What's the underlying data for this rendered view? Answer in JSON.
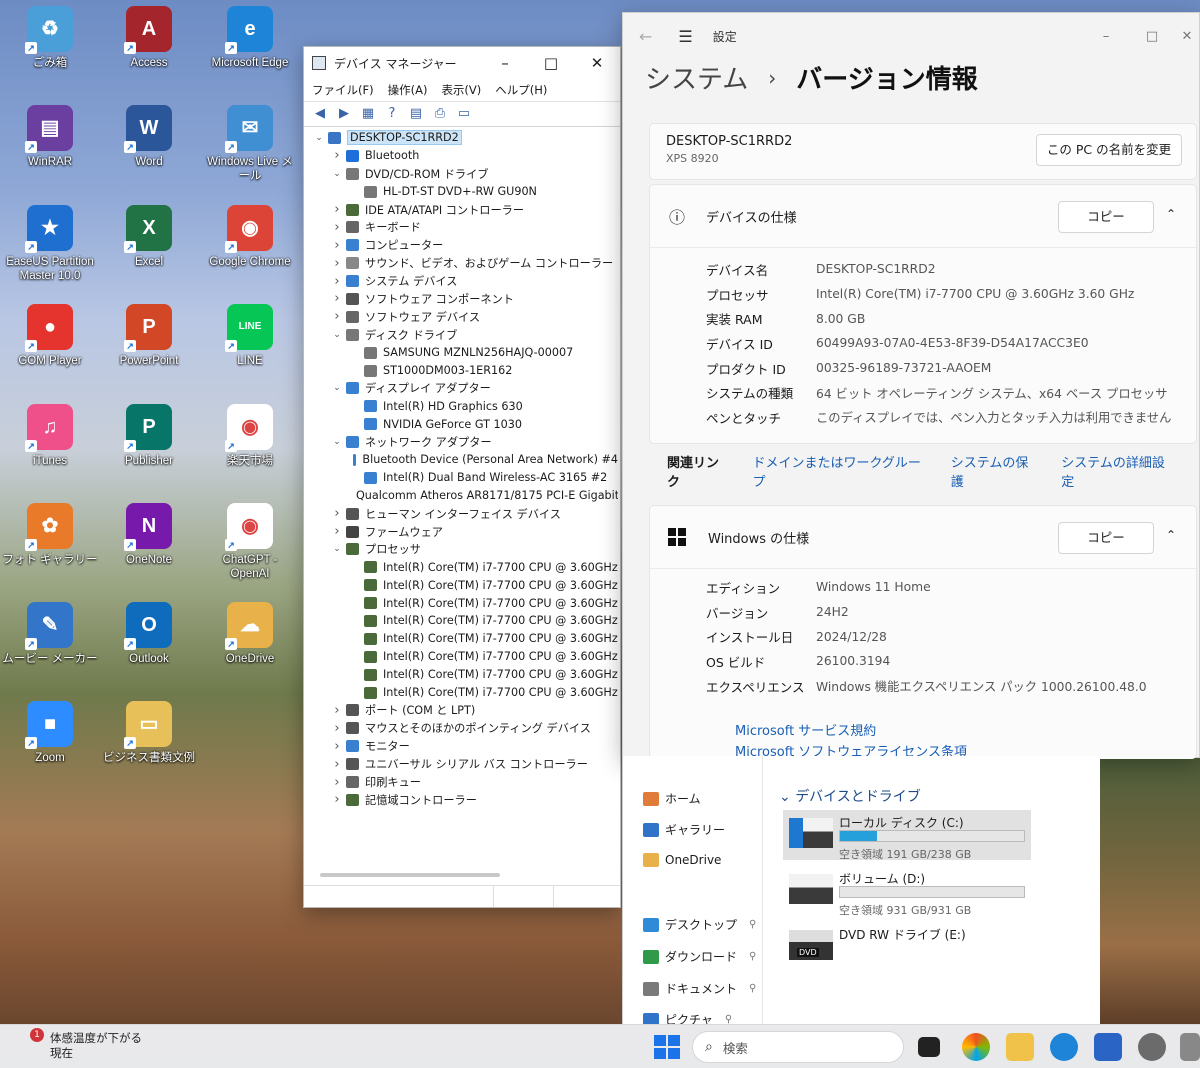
{
  "desktop": {
    "icons": [
      {
        "label": "ごみ箱",
        "color": "#4a9fd8",
        "glyph": "♻"
      },
      {
        "label": "Access",
        "color": "#a4262c",
        "glyph": "A"
      },
      {
        "label": "Microsoft Edge",
        "color": "#1d84d8",
        "glyph": "e"
      },
      {
        "label": "WinRAR",
        "color": "#6b3fa0",
        "glyph": "▤"
      },
      {
        "label": "Word",
        "color": "#2b579a",
        "glyph": "W"
      },
      {
        "label": "Windows Live メール",
        "color": "#3f8fd2",
        "glyph": "✉"
      },
      {
        "label": "EaseUS Partition Master 10.0",
        "color": "#1f6fd0",
        "glyph": "★"
      },
      {
        "label": "Excel",
        "color": "#217346",
        "glyph": "X"
      },
      {
        "label": "Google Chrome",
        "color": "#db4437",
        "glyph": "◉"
      },
      {
        "label": "GOM Player",
        "color": "#e5342d",
        "glyph": "●"
      },
      {
        "label": "PowerPoint",
        "color": "#d24726",
        "glyph": "P"
      },
      {
        "label": "LINE",
        "color": "#06c755",
        "glyph": "LINE"
      },
      {
        "label": "iTunes",
        "color": "#f0508a",
        "glyph": "♫"
      },
      {
        "label": "Publisher",
        "color": "#077568",
        "glyph": "P"
      },
      {
        "label": "楽天市場",
        "color": "#ffffff",
        "glyph": "◉"
      },
      {
        "label": "フォト ギャラリー",
        "color": "#e87a2a",
        "glyph": "✿"
      },
      {
        "label": "OneNote",
        "color": "#7719aa",
        "glyph": "N"
      },
      {
        "label": "ChatGPT - OpenAI",
        "color": "#ffffff",
        "glyph": "◉"
      },
      {
        "label": "ムービー メーカー",
        "color": "#3275c9",
        "glyph": "✎"
      },
      {
        "label": "Outlook",
        "color": "#0f6cbd",
        "glyph": "O"
      },
      {
        "label": "OneDrive",
        "color": "#e8b14a",
        "glyph": "☁"
      },
      {
        "label": "Zoom",
        "color": "#2d8cff",
        "glyph": "■"
      },
      {
        "label": "ビジネス書類文例",
        "color": "#e8c05a",
        "glyph": "▭"
      }
    ]
  },
  "devmgr": {
    "title": "デバイス マネージャー",
    "menu": [
      "ファイル(F)",
      "操作(A)",
      "表示(V)",
      "ヘルプ(H)"
    ],
    "tree": [
      {
        "label": "DESKTOP-SC1RRD2",
        "level": 0,
        "exp": "v",
        "color": "#3a74c4",
        "sel": true
      },
      {
        "label": "Bluetooth",
        "level": 1,
        "exp": ">",
        "color": "#1e6fd9"
      },
      {
        "label": "DVD/CD-ROM ドライブ",
        "level": 1,
        "exp": "v",
        "color": "#777777"
      },
      {
        "label": "HL-DT-ST DVD+-RW GU90N",
        "level": 2,
        "exp": "",
        "color": "#777777"
      },
      {
        "label": "IDE ATA/ATAPI コントローラー",
        "level": 1,
        "exp": ">",
        "color": "#4a6a3a"
      },
      {
        "label": "キーボード",
        "level": 1,
        "exp": ">",
        "color": "#666666"
      },
      {
        "label": "コンピューター",
        "level": 1,
        "exp": ">",
        "color": "#3a80d0"
      },
      {
        "label": "サウンド、ビデオ、およびゲーム コントローラー",
        "level": 1,
        "exp": ">",
        "color": "#888888"
      },
      {
        "label": "システム デバイス",
        "level": 1,
        "exp": ">",
        "color": "#3a80d0"
      },
      {
        "label": "ソフトウェア コンポーネント",
        "level": 1,
        "exp": ">",
        "color": "#555555"
      },
      {
        "label": "ソフトウェア デバイス",
        "level": 1,
        "exp": ">",
        "color": "#666666"
      },
      {
        "label": "ディスク ドライブ",
        "level": 1,
        "exp": "v",
        "color": "#777777"
      },
      {
        "label": "SAMSUNG MZNLN256HAJQ-00007",
        "level": 2,
        "exp": "",
        "color": "#777777"
      },
      {
        "label": "ST1000DM003-1ER162",
        "level": 2,
        "exp": "",
        "color": "#777777"
      },
      {
        "label": "ディスプレイ アダプター",
        "level": 1,
        "exp": "v",
        "color": "#3a80d0"
      },
      {
        "label": "Intel(R) HD Graphics 630",
        "level": 2,
        "exp": "",
        "color": "#3a80d0"
      },
      {
        "label": "NVIDIA GeForce GT 1030",
        "level": 2,
        "exp": "",
        "color": "#3a80d0"
      },
      {
        "label": "ネットワーク アダプター",
        "level": 1,
        "exp": "v",
        "color": "#3a80d0"
      },
      {
        "label": "Bluetooth Device (Personal Area Network) #4",
        "level": 2,
        "exp": "",
        "color": "#3a80d0"
      },
      {
        "label": "Intel(R) Dual Band Wireless-AC 3165 #2",
        "level": 2,
        "exp": "",
        "color": "#3a80d0"
      },
      {
        "label": "Qualcomm Atheros AR8171/8175 PCI-E Gigabit",
        "level": 2,
        "exp": "",
        "color": "#3a80d0"
      },
      {
        "label": "ヒューマン インターフェイス デバイス",
        "level": 1,
        "exp": ">",
        "color": "#555555"
      },
      {
        "label": "ファームウェア",
        "level": 1,
        "exp": ">",
        "color": "#444444"
      },
      {
        "label": "プロセッサ",
        "level": 1,
        "exp": "v",
        "color": "#4a6a3a"
      },
      {
        "label": "Intel(R) Core(TM) i7-7700 CPU @ 3.60GHz",
        "level": 2,
        "exp": "",
        "color": "#4a6a3a"
      },
      {
        "label": "Intel(R) Core(TM) i7-7700 CPU @ 3.60GHz",
        "level": 2,
        "exp": "",
        "color": "#4a6a3a"
      },
      {
        "label": "Intel(R) Core(TM) i7-7700 CPU @ 3.60GHz",
        "level": 2,
        "exp": "",
        "color": "#4a6a3a"
      },
      {
        "label": "Intel(R) Core(TM) i7-7700 CPU @ 3.60GHz",
        "level": 2,
        "exp": "",
        "color": "#4a6a3a"
      },
      {
        "label": "Intel(R) Core(TM) i7-7700 CPU @ 3.60GHz",
        "level": 2,
        "exp": "",
        "color": "#4a6a3a"
      },
      {
        "label": "Intel(R) Core(TM) i7-7700 CPU @ 3.60GHz",
        "level": 2,
        "exp": "",
        "color": "#4a6a3a"
      },
      {
        "label": "Intel(R) Core(TM) i7-7700 CPU @ 3.60GHz",
        "level": 2,
        "exp": "",
        "color": "#4a6a3a"
      },
      {
        "label": "Intel(R) Core(TM) i7-7700 CPU @ 3.60GHz",
        "level": 2,
        "exp": "",
        "color": "#4a6a3a"
      },
      {
        "label": "ポート (COM と LPT)",
        "level": 1,
        "exp": ">",
        "color": "#555555"
      },
      {
        "label": "マウスとそのほかのポインティング デバイス",
        "level": 1,
        "exp": ">",
        "color": "#555555"
      },
      {
        "label": "モニター",
        "level": 1,
        "exp": ">",
        "color": "#3a80d0"
      },
      {
        "label": "ユニバーサル シリアル バス コントローラー",
        "level": 1,
        "exp": ">",
        "color": "#555555"
      },
      {
        "label": "印刷キュー",
        "level": 1,
        "exp": ">",
        "color": "#666666"
      },
      {
        "label": "記憶域コントローラー",
        "level": 1,
        "exp": ">",
        "color": "#4a6a3a"
      }
    ]
  },
  "settings": {
    "app": "設定",
    "breadcrumb_parent": "システム",
    "breadcrumb_current": "バージョン情報",
    "pc_name": "DESKTOP-SC1RRD2",
    "pc_model": "XPS 8920",
    "rename_button": "この PC の名前を変更",
    "device_spec_title": "デバイスの仕様",
    "copy_label": "コピー",
    "device_specs": [
      {
        "k": "デバイス名",
        "v": "DESKTOP-SC1RRD2"
      },
      {
        "k": "プロセッサ",
        "v": "Intel(R) Core(TM) i7-7700 CPU @ 3.60GHz   3.60 GHz"
      },
      {
        "k": "実装 RAM",
        "v": "8.00 GB"
      },
      {
        "k": "デバイス ID",
        "v": "60499A93-07A0-4E53-8F39-D54A17ACC3E0"
      },
      {
        "k": "プロダクト ID",
        "v": "00325-96189-73721-AAOEM"
      },
      {
        "k": "システムの種類",
        "v": "64 ビット オペレーティング システム、x64 ベース プロセッサ"
      },
      {
        "k": "ペンとタッチ",
        "v": "このディスプレイでは、ペン入力とタッチ入力は利用できません"
      }
    ],
    "related_label": "関連リンク",
    "related_links": [
      "ドメインまたはワークグループ",
      "システムの保護",
      "システムの詳細設定"
    ],
    "windows_spec_title": "Windows の仕様",
    "windows_specs": [
      {
        "k": "エディション",
        "v": "Windows 11 Home"
      },
      {
        "k": "バージョン",
        "v": "24H2"
      },
      {
        "k": "インストール日",
        "v": "2024/12/28"
      },
      {
        "k": "OS ビルド",
        "v": "26100.3194"
      },
      {
        "k": "エクスペリエンス",
        "v": "Windows 機能エクスペリエンス パック 1000.26100.48.0"
      }
    ],
    "ms_links": [
      "Microsoft サービス規約",
      "Microsoft ソフトウェアライセンス条項"
    ]
  },
  "explorer": {
    "nav": [
      {
        "label": "ホーム",
        "color": "#e07b39",
        "pin": false
      },
      {
        "label": "ギャラリー",
        "color": "#2f74c8",
        "pin": false
      },
      {
        "label": "OneDrive",
        "color": "#e8b14a",
        "pin": false
      },
      {
        "label": "デスクトップ",
        "color": "#2f8ad8",
        "pin": true
      },
      {
        "label": "ダウンロード",
        "color": "#2f9a4a",
        "pin": true
      },
      {
        "label": "ドキュメント",
        "color": "#7a7a7a",
        "pin": true
      },
      {
        "label": "ピクチャ",
        "color": "#2f74c8",
        "pin": true
      }
    ],
    "drives_heading": "デバイスとドライブ",
    "drives": [
      {
        "name": "ローカル ディスク (C:)",
        "free": "空き領域 191 GB/238 GB",
        "used_fraction": 0.2,
        "bar": true
      },
      {
        "name": "ボリューム (D:)",
        "free": "空き領域 931 GB/931 GB",
        "used_fraction": 0.0,
        "bar": true
      },
      {
        "name": "DVD RW ドライブ (E:)",
        "free": "",
        "used_fraction": 0.0,
        "bar": false
      }
    ],
    "dvd_label": "DVD"
  },
  "taskbar": {
    "weather_badge": "1",
    "weather_line1": "体感温度が下がる",
    "weather_line2": "現在",
    "search_placeholder": "検索"
  }
}
